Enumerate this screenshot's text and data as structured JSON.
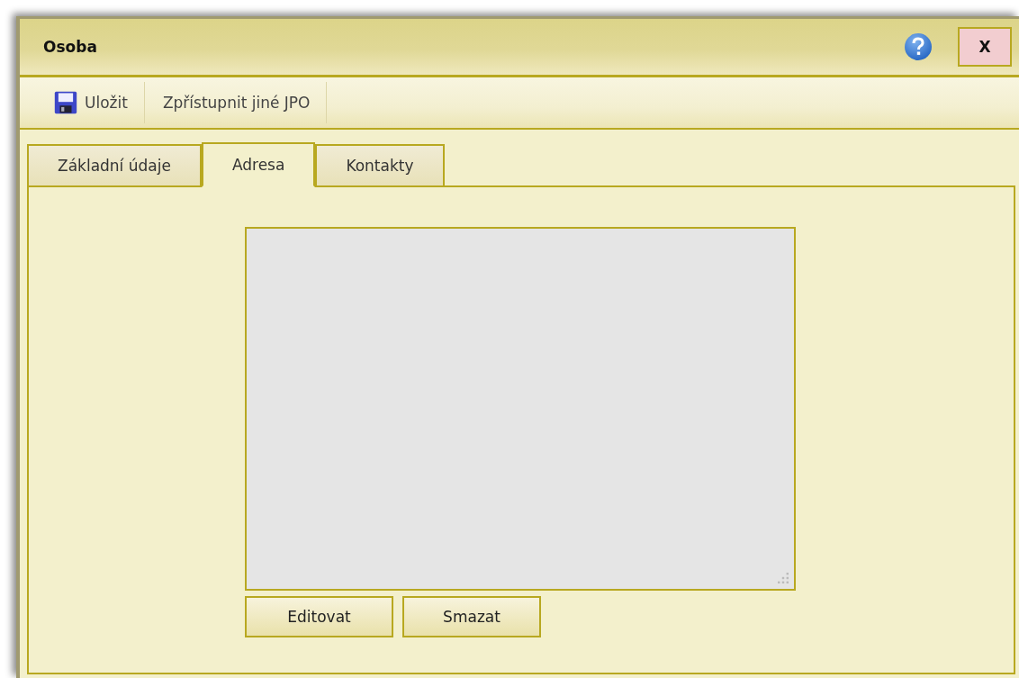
{
  "window": {
    "title": "Osoba"
  },
  "toolbar": [
    {
      "label": "Uložit",
      "kind": "save"
    },
    {
      "label": "Zpřístupnit jiné JPO",
      "kind": "plain"
    }
  ],
  "tabs": [
    {
      "label": "Základní údaje",
      "selected": false
    },
    {
      "label": "Adresa",
      "selected": true
    },
    {
      "label": "Kontakty",
      "selected": false
    }
  ],
  "close_button": "X",
  "buttons": [
    "Editovat",
    "Smazat"
  ]
}
